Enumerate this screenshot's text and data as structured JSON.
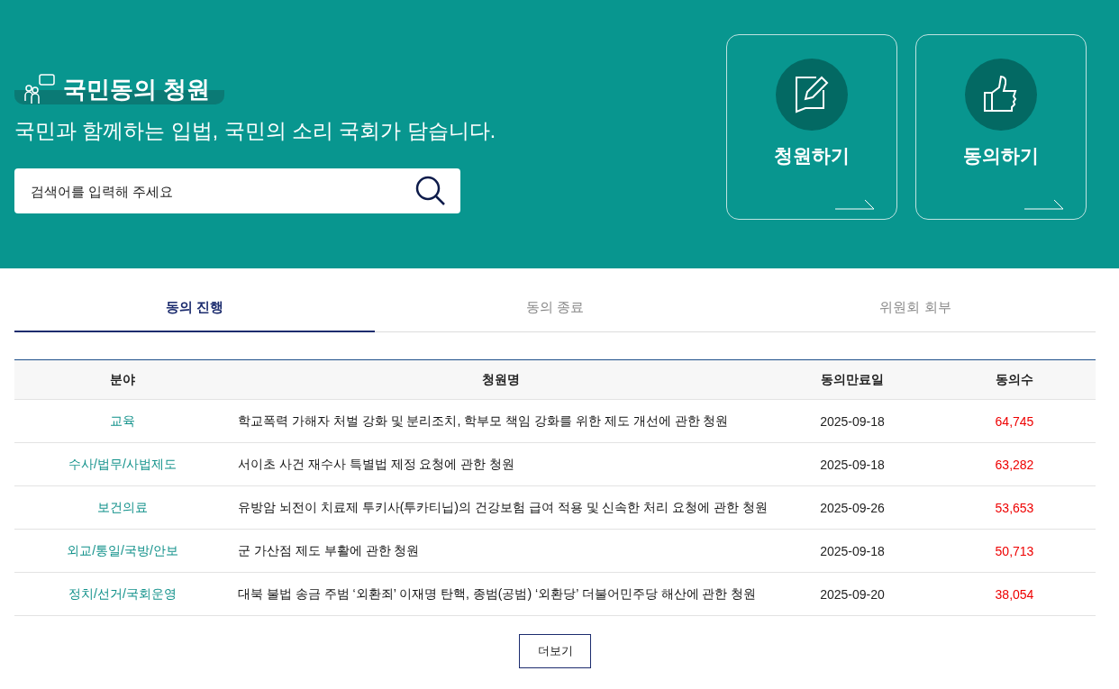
{
  "hero": {
    "title": "국민동의 청원",
    "subtitle": "국민과 함께하는 입법, 국민의 소리 국회가 담습니다.",
    "search": {
      "placeholder": "검색어를 입력해 주세요"
    },
    "actions": [
      {
        "kind": "write",
        "label": "청원하기"
      },
      {
        "kind": "agree",
        "label": "동의하기"
      }
    ]
  },
  "tabs": [
    {
      "label": "동의 진행",
      "selected": true
    },
    {
      "label": "동의 종료",
      "selected": false
    },
    {
      "label": "위원회 회부",
      "selected": false
    }
  ],
  "table": {
    "columns": [
      "분야",
      "청원명",
      "동의만료일",
      "동의수"
    ],
    "rows": [
      [
        "교육",
        "학교폭력 가해자 처벌 강화 및 분리조치, 학부모 책임 강화를 위한 제도 개선에 관한 청원",
        "2025-09-18",
        "64,745"
      ],
      [
        "수사/법무/사법제도",
        "서이초 사건 재수사 특별법 제정 요청에 관한 청원",
        "2025-09-18",
        "63,282"
      ],
      [
        "보건의료",
        "유방암 뇌전이 치료제 투키사(투카티닙)의 건강보험 급여 적용 및 신속한 처리 요청에 관한 청원",
        "2025-09-26",
        "53,653"
      ],
      [
        "외교/통일/국방/안보",
        "군 가산점 제도 부활에 관한 청원",
        "2025-09-18",
        "50,713"
      ],
      [
        "정치/선거/국회운영",
        "대북 불법 송금 주범 ‘외환죄’ 이재명 탄핵, 종범(공범) ‘외환당’ 더불어민주당 해산에 관한 청원",
        "2025-09-20",
        "38,054"
      ]
    ]
  },
  "more_button": "더보기"
}
